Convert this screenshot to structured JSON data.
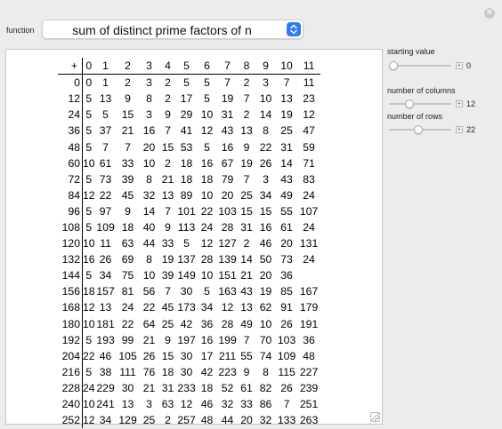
{
  "function_label": "function",
  "function_value": "sum of distinct prime factors of n",
  "controls": [
    {
      "label": "starting value",
      "value": "0",
      "position": 0.0
    },
    {
      "label": "number of columns",
      "value": "12",
      "position": 0.3
    },
    {
      "label": "number of rows",
      "value": "22",
      "position": 0.47
    }
  ],
  "table": {
    "corner": "+",
    "columns": [
      "0",
      "1",
      "2",
      "3",
      "4",
      "5",
      "6",
      "7",
      "8",
      "9",
      "10",
      "11"
    ],
    "rows": [
      {
        "label": "0",
        "cells": [
          "0",
          "1",
          "2",
          "3",
          "2",
          "5",
          "5",
          "7",
          "2",
          "3",
          "7",
          "11"
        ]
      },
      {
        "label": "12",
        "cells": [
          "5",
          "13",
          "9",
          "8",
          "2",
          "17",
          "5",
          "19",
          "7",
          "10",
          "13",
          "23"
        ]
      },
      {
        "label": "24",
        "cells": [
          "5",
          "5",
          "15",
          "3",
          "9",
          "29",
          "10",
          "31",
          "2",
          "14",
          "19",
          "12"
        ]
      },
      {
        "label": "36",
        "cells": [
          "5",
          "37",
          "21",
          "16",
          "7",
          "41",
          "12",
          "43",
          "13",
          "8",
          "25",
          "47"
        ]
      },
      {
        "label": "48",
        "cells": [
          "5",
          "7",
          "7",
          "20",
          "15",
          "53",
          "5",
          "16",
          "9",
          "22",
          "31",
          "59"
        ]
      },
      {
        "label": "60",
        "cells": [
          "10",
          "61",
          "33",
          "10",
          "2",
          "18",
          "16",
          "67",
          "19",
          "26",
          "14",
          "71"
        ]
      },
      {
        "label": "72",
        "cells": [
          "5",
          "73",
          "39",
          "8",
          "21",
          "18",
          "18",
          "79",
          "7",
          "3",
          "43",
          "83"
        ]
      },
      {
        "label": "84",
        "cells": [
          "12",
          "22",
          "45",
          "32",
          "13",
          "89",
          "10",
          "20",
          "25",
          "34",
          "49",
          "24"
        ]
      },
      {
        "label": "96",
        "cells": [
          "5",
          "97",
          "9",
          "14",
          "7",
          "101",
          "22",
          "103",
          "15",
          "15",
          "55",
          "107"
        ]
      },
      {
        "label": "108",
        "cells": [
          "5",
          "109",
          "18",
          "40",
          "9",
          "113",
          "24",
          "28",
          "31",
          "16",
          "61",
          "24"
        ]
      },
      {
        "label": "120",
        "cells": [
          "10",
          "11",
          "63",
          "44",
          "33",
          "5",
          "12",
          "127",
          "2",
          "46",
          "20",
          "131"
        ]
      },
      {
        "label": "132",
        "cells": [
          "16",
          "26",
          "69",
          "8",
          "19",
          "137",
          "28",
          "139",
          "14",
          "50",
          "73",
          "24"
        ]
      },
      {
        "label": "144",
        "cells": [
          "5",
          "34",
          "75",
          "10",
          "39",
          "149",
          "10",
          "151",
          "21",
          "20",
          "36",
          ""
        ]
      },
      {
        "label": "156",
        "cells": [
          "18",
          "157",
          "81",
          "56",
          "7",
          "30",
          "5",
          "163",
          "43",
          "19",
          "85",
          "167"
        ]
      },
      {
        "label": "168",
        "cells": [
          "12",
          "13",
          "24",
          "22",
          "45",
          "173",
          "34",
          "12",
          "13",
          "62",
          "91",
          "179"
        ]
      },
      {
        "label": "180",
        "cells": [
          "10",
          "181",
          "22",
          "64",
          "25",
          "42",
          "36",
          "28",
          "49",
          "10",
          "26",
          "191"
        ]
      },
      {
        "label": "192",
        "cells": [
          "5",
          "193",
          "99",
          "21",
          "9",
          "197",
          "16",
          "199",
          "7",
          "70",
          "103",
          "36"
        ]
      },
      {
        "label": "204",
        "cells": [
          "22",
          "46",
          "105",
          "26",
          "15",
          "30",
          "17",
          "211",
          "55",
          "74",
          "109",
          "48"
        ]
      },
      {
        "label": "216",
        "cells": [
          "5",
          "38",
          "111",
          "76",
          "18",
          "30",
          "42",
          "223",
          "9",
          "8",
          "115",
          "227"
        ]
      },
      {
        "label": "228",
        "cells": [
          "24",
          "229",
          "30",
          "21",
          "31",
          "233",
          "18",
          "52",
          "61",
          "82",
          "26",
          "239"
        ]
      },
      {
        "label": "240",
        "cells": [
          "10",
          "241",
          "13",
          "3",
          "63",
          "12",
          "46",
          "32",
          "33",
          "86",
          "7",
          "251"
        ]
      },
      {
        "label": "252",
        "cells": [
          "12",
          "34",
          "129",
          "25",
          "2",
          "257",
          "48",
          "44",
          "20",
          "32",
          "133",
          "263"
        ]
      }
    ]
  }
}
